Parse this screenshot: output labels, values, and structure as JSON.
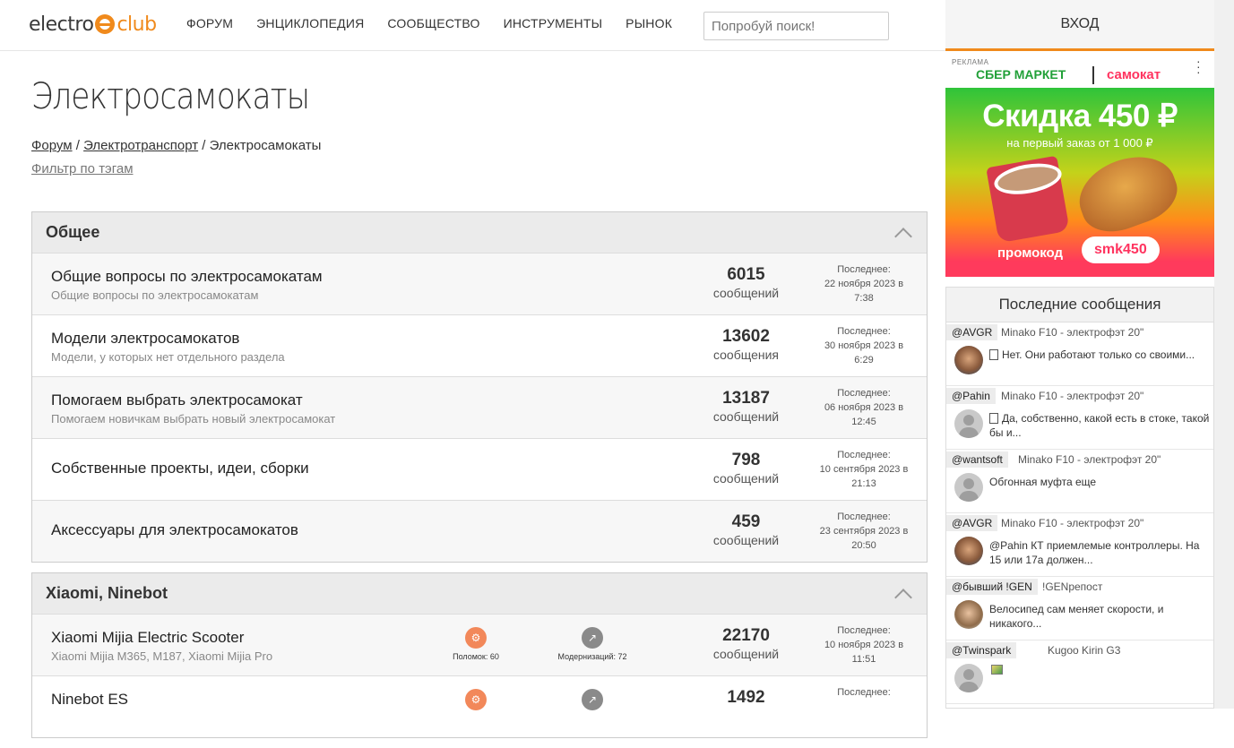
{
  "header": {
    "logo_left": "electro",
    "logo_right": "club",
    "nav": [
      "ФОРУМ",
      "ЭНЦИКЛОПЕДИЯ",
      "СООБЩЕСТВО",
      "ИНСТРУМЕНТЫ",
      "РЫНОК"
    ],
    "search_placeholder": "Попробуй поиск!",
    "login": "ВХОД"
  },
  "page": {
    "title": "Электросамокаты",
    "breadcrumb": [
      "Форум",
      "Электротранспорт",
      "Электросамокаты"
    ],
    "breadcrumb_sep": "/",
    "filter": "Фильтр по тэгам"
  },
  "sections": [
    {
      "title": "Общее",
      "rows": [
        {
          "title": "Общие вопросы по электросамокатам",
          "desc": "Общие вопросы по электросамокатам",
          "count": "6015",
          "word": "сообщений",
          "last_label": "Последнее:",
          "last_date": "22 ноября 2023 в",
          "last_time": "7:38"
        },
        {
          "title": "Модели электросамокатов",
          "desc": "Модели, у которых нет отдельного раздела",
          "count": "13602",
          "word": "сообщения",
          "last_label": "Последнее:",
          "last_date": "30 ноября 2023 в",
          "last_time": "6:29"
        },
        {
          "title": "Помогаем выбрать электросамокат",
          "desc": "Помогаем новичкам выбрать новый электросамокат",
          "count": "13187",
          "word": "сообщений",
          "last_label": "Последнее:",
          "last_date": "06 ноября 2023 в",
          "last_time": "12:45"
        },
        {
          "title": "Собственные проекты, идеи, сборки",
          "desc": "",
          "count": "798",
          "word": "сообщений",
          "last_label": "Последнее:",
          "last_date": "10 сентября 2023 в",
          "last_time": "21:13"
        },
        {
          "title": "Аксессуары для электросамокатов",
          "desc": "",
          "count": "459",
          "word": "сообщений",
          "last_label": "Последнее:",
          "last_date": "23 сентября 2023 в",
          "last_time": "20:50"
        }
      ]
    },
    {
      "title": "Xiaomi, Ninebot",
      "rows": [
        {
          "title": "Xiaomi Mijia Electric Scooter",
          "desc": "Xiaomi Mijia M365, M187, Xiaomi Mijia Pro",
          "count": "22170",
          "word": "сообщений",
          "last_label": "Последнее:",
          "last_date": "10 ноября 2023 в",
          "last_time": "11:51",
          "badge1": "Поломок: 60",
          "badge2": "Модернизаций: 72"
        },
        {
          "title": "Ninebot ES",
          "desc": "",
          "count": "1492",
          "word": "",
          "last_label": "Последнее:",
          "last_date": "",
          "last_time": ""
        }
      ]
    }
  ],
  "ad": {
    "label": "РЕКЛАМА",
    "brand1": "СБЕР МАРКЕТ",
    "brand2": "самокат",
    "headline": "Скидка 450 ₽",
    "sub": "на первый заказ от 1 000 ₽",
    "promo": "промокод",
    "code": "smk450"
  },
  "latest": {
    "title": "Последние сообщения",
    "messages": [
      {
        "user": "@AVGR",
        "topic": "Minako F10 - электрофэт 20\"",
        "text": "Нет. Они работают только со своими...",
        "avatar": "photo",
        "clip": true
      },
      {
        "user": "@Pahin",
        "topic": "Minako F10 - электрофэт 20\"",
        "text": "Да, собственно, какой есть в стоке, такой бы и...",
        "avatar": "person",
        "clip": true
      },
      {
        "user": "@wantsoft",
        "topic": "Minako F10 - электрофэт 20\"",
        "text": "Обгонная муфта еще",
        "avatar": "person",
        "clip": false
      },
      {
        "user": "@AVGR",
        "topic": "Minako F10 - электрофэт 20\"",
        "text": "@Pahin КТ приемлемые контроллеры. На 15 или 17а должен...",
        "avatar": "photo",
        "clip": false
      },
      {
        "user": "@бывший !GEN",
        "topic": "!GENрепост",
        "text": "Велосипед сам меняет скорости, и никакого...",
        "avatar": "photo2",
        "clip": false
      },
      {
        "user": "@Twinspark",
        "topic": "Kugoo Kirin G3",
        "text": "",
        "avatar": "person",
        "clip": false,
        "image": true
      }
    ]
  }
}
